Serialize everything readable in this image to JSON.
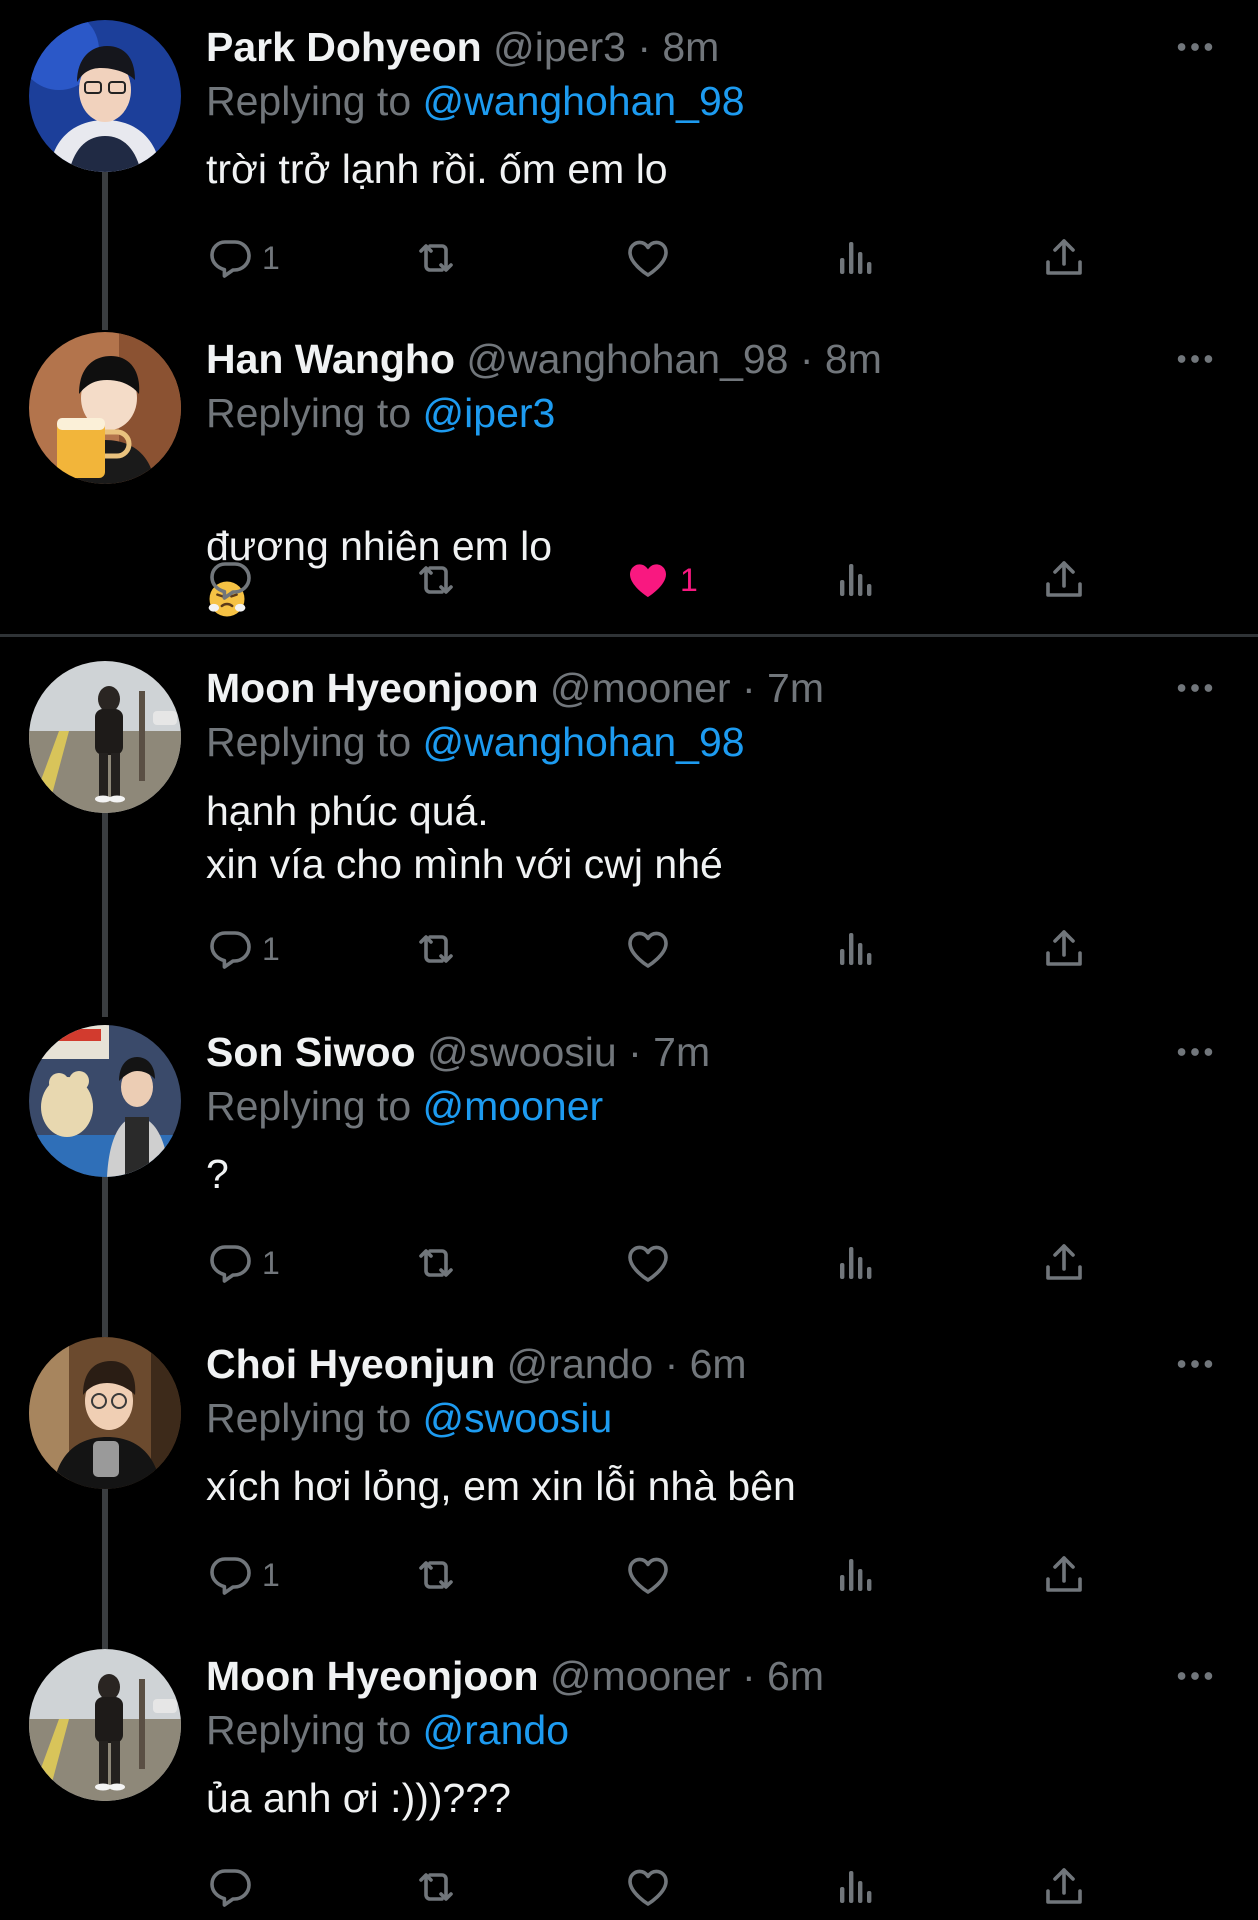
{
  "labels": {
    "replying_to": "Replying to"
  },
  "tweets": [
    {
      "name": "Park Dohyeon",
      "handle": "@iper3",
      "time": "· 8m",
      "reply_to": "@wanghohan_98",
      "text": "trời trở lạnh rồi. ốm em lo",
      "reply_count": "1",
      "like_count": "",
      "liked": false
    },
    {
      "name": "Han Wangho",
      "handle": "@wanghohan_98",
      "time": "· 8m",
      "reply_to": "@iper3",
      "text": "đương nhiên em lo",
      "emoji": "face-with-steam-emoji",
      "reply_count": "",
      "like_count": "1",
      "liked": true
    },
    {
      "name": "Moon Hyeonjoon",
      "handle": "@mooner",
      "time": "· 7m",
      "reply_to": "@wanghohan_98",
      "text": "hạnh phúc quá.\nxin vía cho mình với cwj nhé",
      "reply_count": "1",
      "like_count": "",
      "liked": false
    },
    {
      "name": "Son Siwoo",
      "handle": "@swoosiu",
      "time": "· 7m",
      "reply_to": "@mooner",
      "text": "?",
      "reply_count": "1",
      "like_count": "",
      "liked": false
    },
    {
      "name": "Choi Hyeonjun",
      "handle": "@rando",
      "time": "· 6m",
      "reply_to": "@swoosiu",
      "text": "xích hơi lỏng, em xin lỗi nhà bên",
      "reply_count": "1",
      "like_count": "",
      "liked": false
    },
    {
      "name": "Moon Hyeonjoon",
      "handle": "@mooner",
      "time": "· 6m",
      "reply_to": "@rando",
      "text": "ủa anh ơi :)))???",
      "reply_count": "",
      "like_count": "",
      "liked": false
    }
  ],
  "colors": {
    "background": "#000000",
    "text": "#e7e9ea",
    "muted": "#71767b",
    "link": "#1d9bf0",
    "like": "#f91880",
    "thread_line": "#3a3d40"
  },
  "icons": [
    "reply-icon",
    "retweet-icon",
    "like-icon",
    "views-icon",
    "share-icon",
    "more-icon"
  ]
}
